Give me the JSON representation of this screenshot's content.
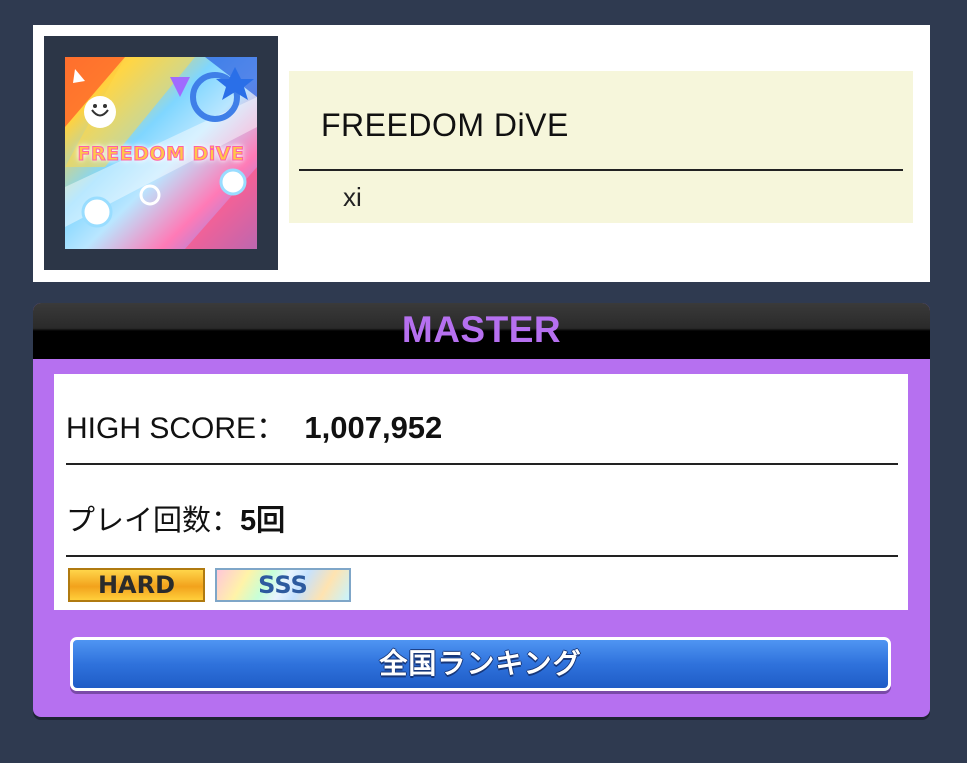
{
  "song": {
    "title": "FREEDOM DiVE",
    "artist": "xi",
    "jacket": {
      "text": "FREEDOM DiVE",
      "colors": [
        "#ff8a3c",
        "#ffd23f",
        "#7fd6ff",
        "#ff7ab6",
        "#5a8cff"
      ]
    }
  },
  "difficulty": {
    "name": "MASTER",
    "color": "#b670f0"
  },
  "stats": {
    "high_score_label": "HIGH SCORE：",
    "high_score_value": "1,007,952",
    "play_count_label": "プレイ回数：",
    "play_count_value": "5回"
  },
  "badges": {
    "lamp": "HARD",
    "rank": "SSS"
  },
  "button": {
    "ranking_label": "全国ランキング"
  },
  "colors": {
    "background": "#2f3a50",
    "info_box": "#f6f6db",
    "button_blue": "#2f72dc"
  }
}
